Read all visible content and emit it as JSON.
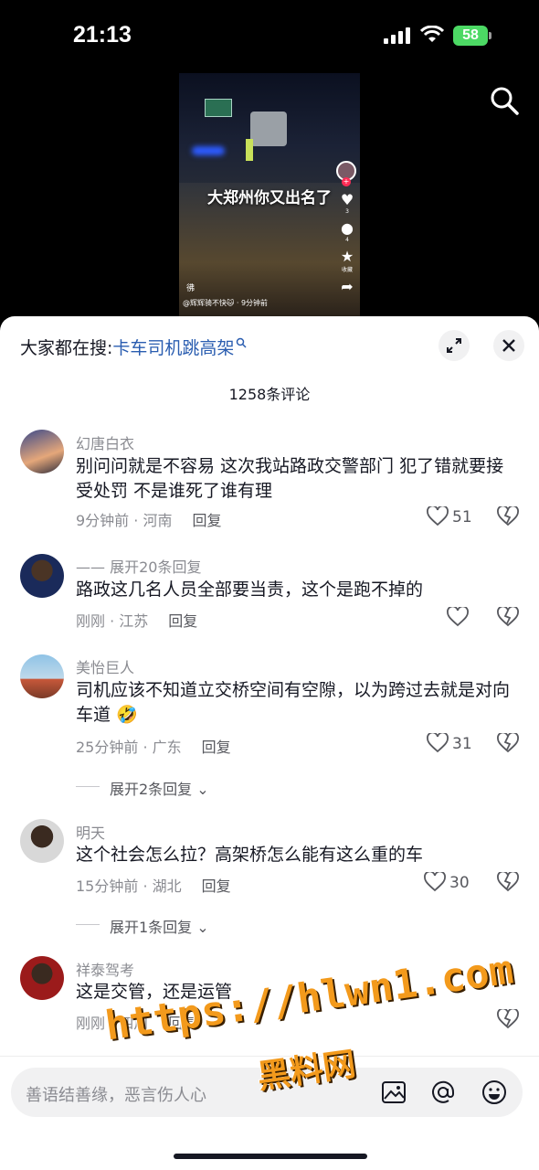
{
  "status_bar": {
    "time": "21:13",
    "battery": "58"
  },
  "video": {
    "caption": "大郑州你又出名了",
    "author_line": "@辉辉骑不快🐱 · 9分钟前",
    "desc": "彿",
    "like_count": "3",
    "comment_count": "4",
    "collect_label": "收藏"
  },
  "sheet": {
    "search_prefix": "大家都在搜:",
    "search_keyword": "卡车司机跳高架",
    "comment_count_title": "1258条评论"
  },
  "comments": [
    {
      "name": "幻唐白衣",
      "text": "别问问就是不容易  这次我站路政交警部门 犯了错就要接受处罚 不是谁死了谁有理",
      "meta": "9分钟前 · 河南",
      "reply": "回复",
      "likes": "51"
    },
    {
      "name": "—— 展开20条回复",
      "text": "路政这几名人员全部要当责，这个是跑不掉的",
      "meta": "刚刚 · 江苏",
      "reply": "回复",
      "likes": ""
    },
    {
      "name": "美怡巨人",
      "text": "司机应该不知道立交桥空间有空隙，以为跨过去就是对向车道 🤣",
      "meta": "25分钟前 · 广东",
      "reply": "回复",
      "likes": "31"
    },
    {
      "name": "明天",
      "text": "这个社会怎么拉？高架桥怎么能有这么重的车",
      "meta": "15分钟前 · 湖北",
      "reply": "回复",
      "likes": "30"
    },
    {
      "name": "祥泰驾考",
      "text": "这是交管，还是运管",
      "meta": "刚刚 · 四川",
      "reply": "回复",
      "likes": ""
    }
  ],
  "expanders": {
    "one": "展开2条回复",
    "two": "展开1条回复"
  },
  "input": {
    "placeholder": "善语结善缘，恶言伤人心"
  },
  "watermark": {
    "line1": "https://hlwn1.com",
    "line2": "黑料网"
  },
  "colors": {
    "accent_link": "#2a5db0",
    "sheet_bg": "#ffffff",
    "watermark": "#f39a1c"
  }
}
